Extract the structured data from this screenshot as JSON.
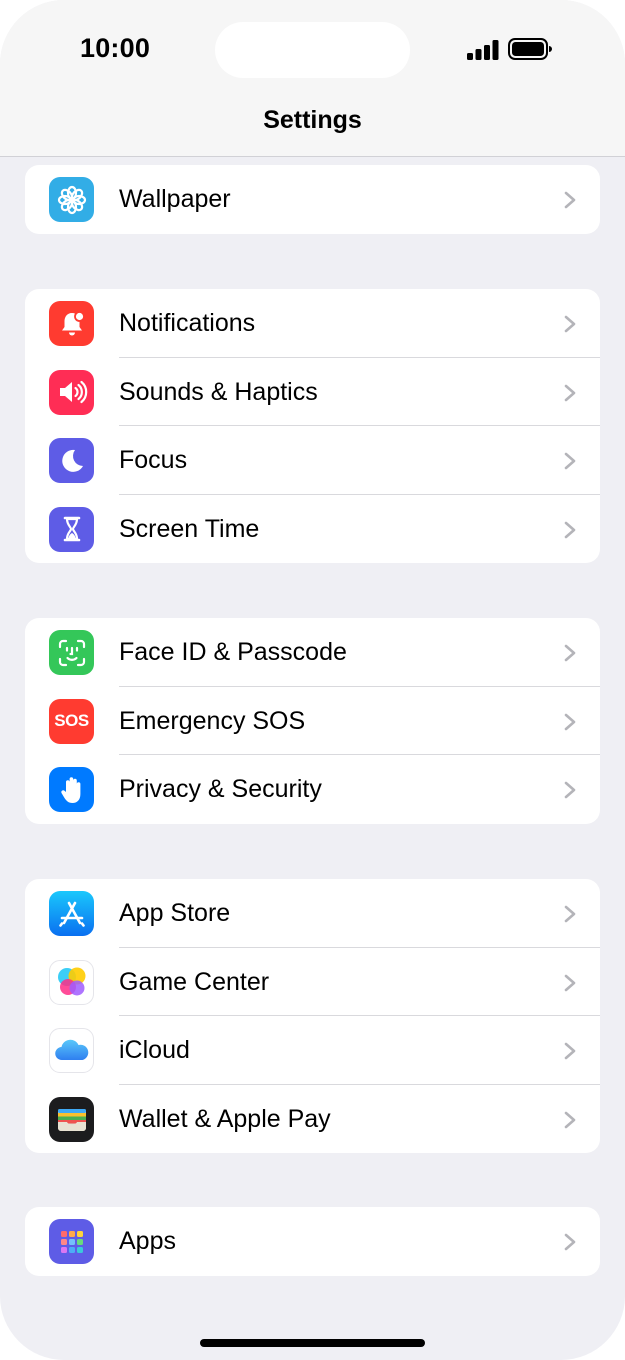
{
  "status_bar": {
    "time": "10:00"
  },
  "nav": {
    "title": "Settings"
  },
  "groups": [
    {
      "items": [
        {
          "label": "Wallpaper",
          "icon": "wallpaper-icon",
          "color": "#32ade6"
        }
      ]
    },
    {
      "items": [
        {
          "label": "Notifications",
          "icon": "notifications-icon",
          "color": "#ff3b30"
        },
        {
          "label": "Sounds & Haptics",
          "icon": "speaker-icon",
          "color": "#ff2d55"
        },
        {
          "label": "Focus",
          "icon": "moon-icon",
          "color": "#5e5ce6"
        },
        {
          "label": "Screen Time",
          "icon": "hourglass-icon",
          "color": "#5e5ce6"
        }
      ]
    },
    {
      "items": [
        {
          "label": "Face ID & Passcode",
          "icon": "face-id-icon",
          "color": "#34c759"
        },
        {
          "label": "Emergency SOS",
          "icon": "sos-icon",
          "color": "#ff3b30",
          "icon_text": "SOS"
        },
        {
          "label": "Privacy & Security",
          "icon": "hand-icon",
          "color": "#007aff"
        }
      ]
    },
    {
      "items": [
        {
          "label": "App Store",
          "icon": "app-store-icon",
          "color": "#0a84ff"
        },
        {
          "label": "Game Center",
          "icon": "game-center-icon",
          "color": "#ffffff"
        },
        {
          "label": "iCloud",
          "icon": "icloud-icon",
          "color": "#ffffff"
        },
        {
          "label": "Wallet & Apple Pay",
          "icon": "wallet-icon",
          "color": "#1c1c1e"
        }
      ]
    },
    {
      "items": [
        {
          "label": "Apps",
          "icon": "apps-grid-icon",
          "color": "#5e5ce6"
        }
      ]
    }
  ]
}
